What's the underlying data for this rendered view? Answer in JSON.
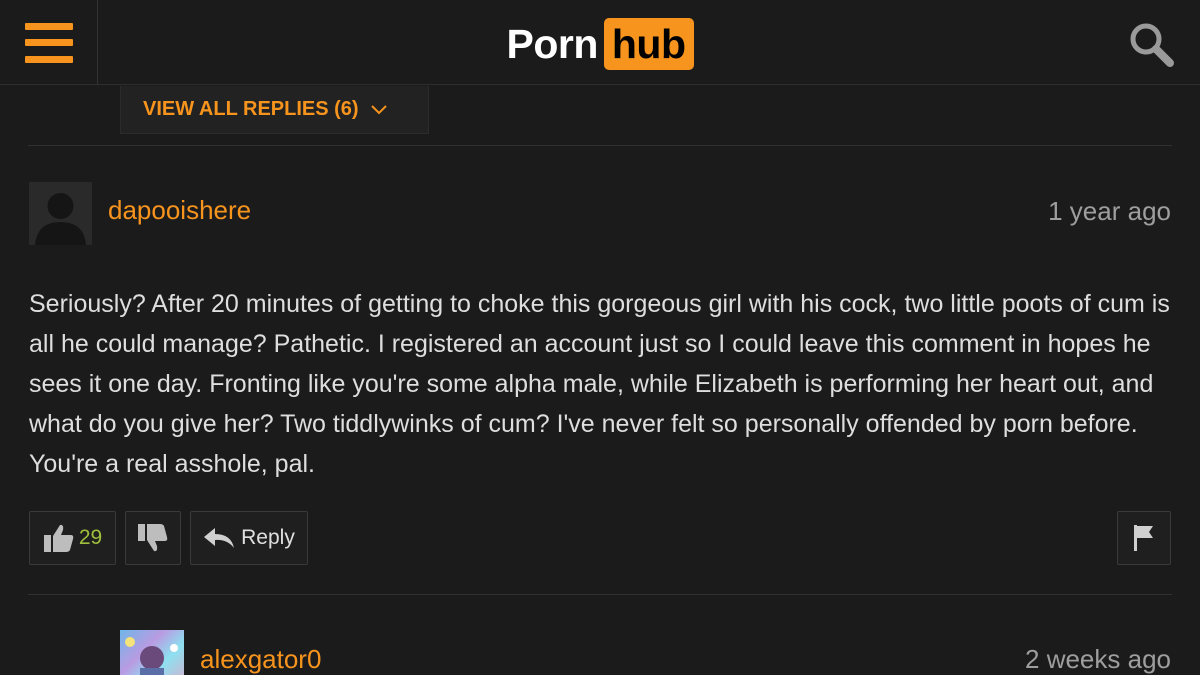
{
  "header": {
    "logo_part1": "Porn",
    "logo_part2": "hub",
    "menu_icon": "hamburger-menu-icon",
    "search_icon": "search-icon",
    "accent_color": "#f7941d"
  },
  "view_replies": {
    "label": "VIEW ALL REPLIES (6)",
    "icon": "chevron-down-icon"
  },
  "comments": [
    {
      "username": "dapooishere",
      "timestamp": "1 year ago",
      "body": "Seriously? After 20 minutes of getting to choke this gorgeous girl with his cock, two little poots of cum is all he could manage? Pathetic. I registered an account just so I could leave this comment in hopes he sees it one day. Fronting like you're some alpha male, while Elizabeth is performing her heart out, and what do you give her? Two tiddlywinks of cum? I've never felt so personally offended by porn before. You're a real asshole, pal.",
      "likes": "29",
      "reply_label": "Reply",
      "icons": [
        "thumbs-up-icon",
        "thumbs-down-icon",
        "reply-arrow-icon",
        "flag-icon"
      ]
    },
    {
      "username": "alexgator0",
      "timestamp": "2 weeks ago"
    }
  ]
}
